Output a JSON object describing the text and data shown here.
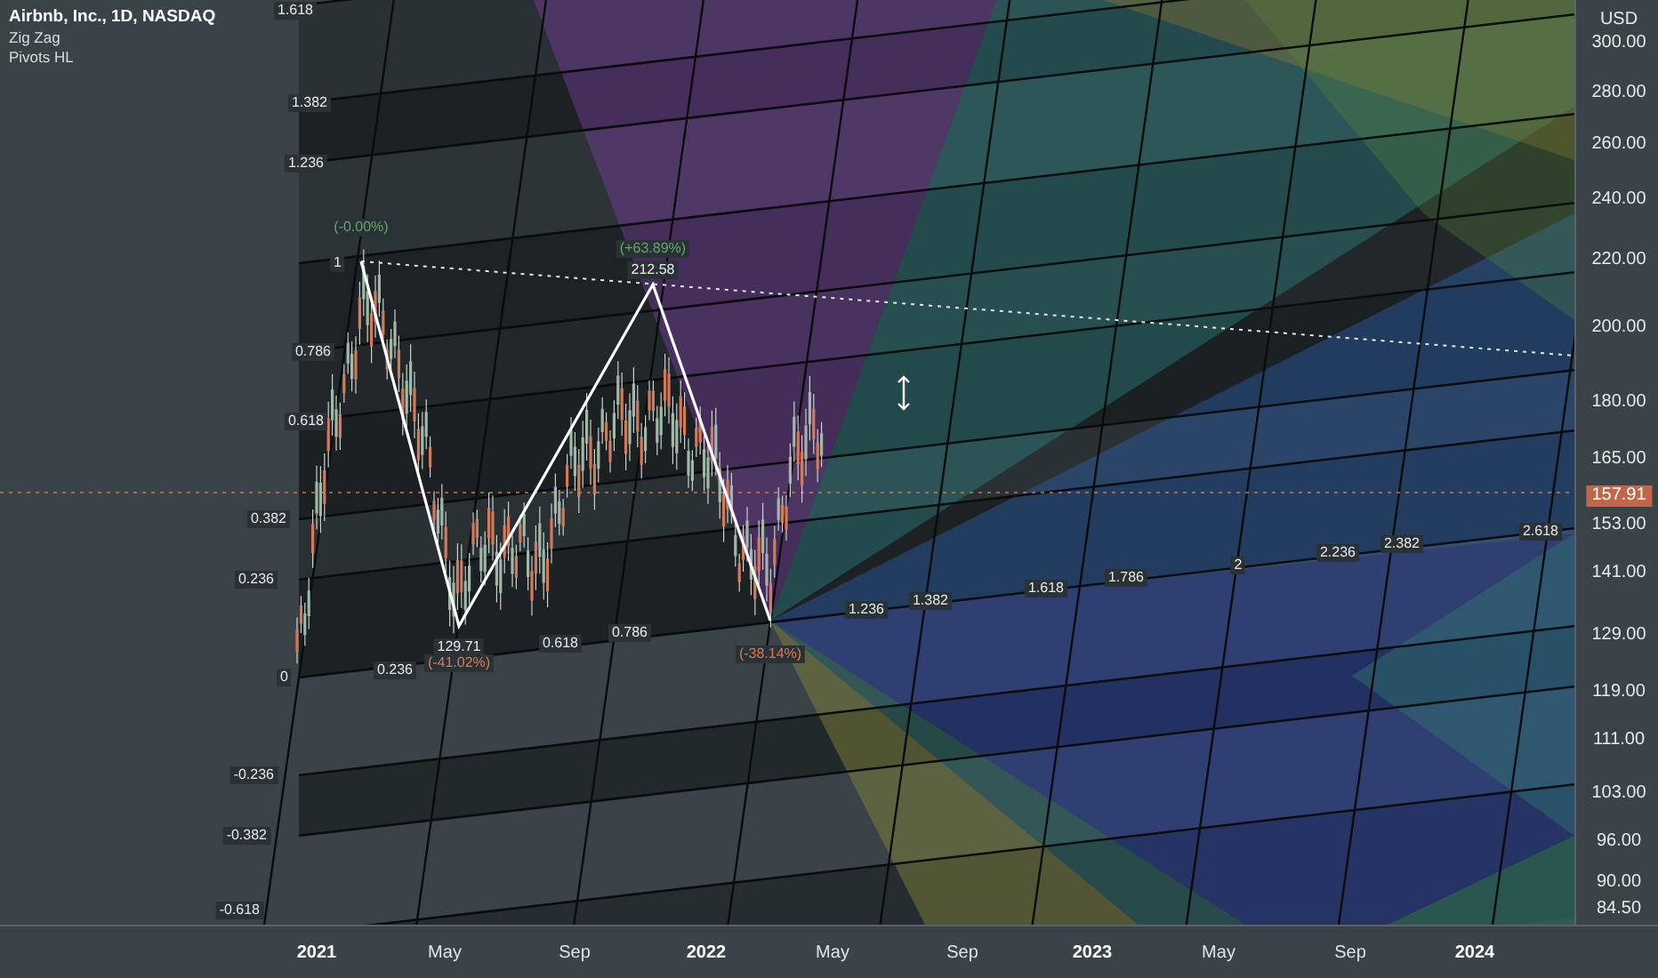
{
  "legend": {
    "symbol": "Airbnb, Inc., 1D, NASDAQ",
    "indicators": [
      "Zig Zag",
      "Pivots HL"
    ]
  },
  "price_axis": {
    "currency": "USD",
    "ticks": [
      "300.00",
      "280.00",
      "260.00",
      "240.00",
      "220.00",
      "200.00",
      "180.00",
      "165.00",
      "153.00",
      "141.00",
      "129.00",
      "119.00",
      "111.00",
      "103.00",
      "96.00",
      "90.00",
      "84.50"
    ],
    "last_price": "157.91"
  },
  "time_axis": {
    "labels": [
      {
        "text": "2021",
        "kind": "year"
      },
      {
        "text": "May",
        "kind": "month"
      },
      {
        "text": "Sep",
        "kind": "month"
      },
      {
        "text": "2022",
        "kind": "year"
      },
      {
        "text": "May",
        "kind": "month"
      },
      {
        "text": "Sep",
        "kind": "month"
      },
      {
        "text": "2023",
        "kind": "year"
      },
      {
        "text": "May",
        "kind": "month"
      },
      {
        "text": "Sep",
        "kind": "month"
      },
      {
        "text": "2024",
        "kind": "year"
      }
    ]
  },
  "fib_levels": {
    "price": [
      "1.618",
      "1.382",
      "1.236",
      "1",
      "0.786",
      "0.618",
      "0.382",
      "0.236",
      "0",
      "-0.236",
      "-0.382",
      "-0.618"
    ],
    "time": [
      "0.236",
      "0.618",
      "0.786",
      "1.236",
      "1.382",
      "1.618",
      "1.786",
      "2",
      "2.236",
      "2.382",
      "2.618"
    ]
  },
  "pivots": [
    {
      "change": "(-0.00%)",
      "kind": "high"
    },
    {
      "price": "212.58",
      "change": "(+63.89%)",
      "kind": "high"
    },
    {
      "price": "129.71",
      "change": "(-41.02%)",
      "kind": "low"
    },
    {
      "change": "(-38.14%)",
      "kind": "low"
    }
  ]
}
